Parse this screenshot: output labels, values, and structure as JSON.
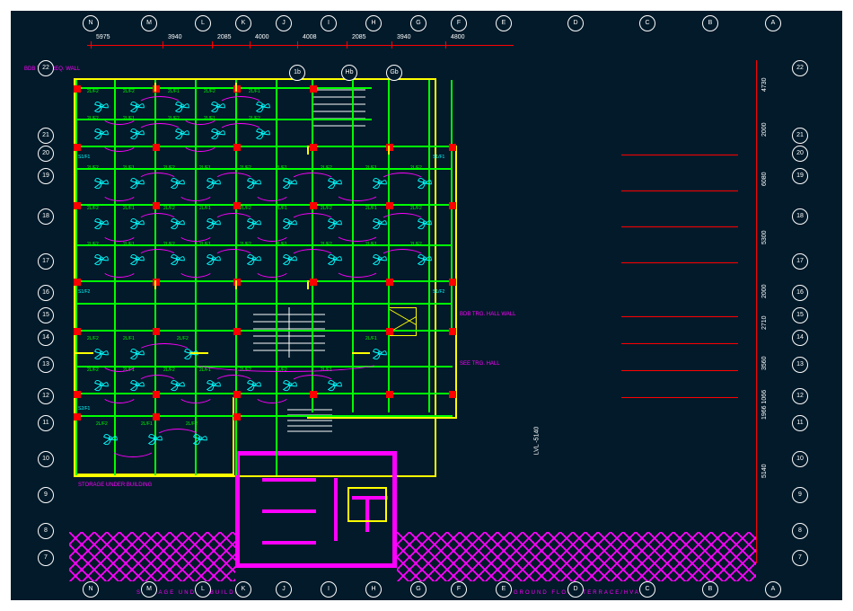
{
  "drawing": {
    "type": "CAD floor plan — HVAC / ceiling fan layout",
    "background": "#021a2a"
  },
  "grid_letters_top": [
    "N",
    "M",
    "L",
    "K",
    "J",
    "I",
    "H",
    "G",
    "F",
    "E",
    "D",
    "C",
    "B",
    "A"
  ],
  "grid_letters_bottom": [
    "N",
    "M",
    "L",
    "K",
    "J",
    "I",
    "H",
    "G",
    "F",
    "E",
    "D",
    "C",
    "B",
    "A"
  ],
  "grid_numbers_left": [
    "22",
    "21",
    "20",
    "19",
    "18",
    "17",
    "16",
    "15",
    "14",
    "13",
    "12",
    "11",
    "10",
    "9",
    "8",
    "7"
  ],
  "grid_numbers_right": [
    "22",
    "21",
    "20",
    "19",
    "18",
    "17",
    "16",
    "15",
    "14",
    "13",
    "12",
    "11",
    "10",
    "9",
    "8",
    "7"
  ],
  "dims_top": [
    "5975",
    "3940",
    "2085",
    "4000",
    "4008",
    "2085",
    "3940",
    "4800"
  ],
  "dims_right": [
    "4730",
    "2000",
    "6080",
    "5300",
    "2000",
    "2710",
    "3560",
    "1966 1066",
    "5140"
  ],
  "interior_bubbles": [
    "1b",
    "Hb",
    "Gb"
  ],
  "fan_tags": [
    "2L/F2",
    "2L/F2",
    "2L/F1",
    "2L/F2",
    "2L/F1",
    "2L/F2",
    "2L/F1",
    "2L/F2",
    "2L/F1"
  ],
  "switch_tags": [
    "S1/F1",
    "S1/F2",
    "S2/F1"
  ],
  "notes": {
    "left_1": "BDB TRG. REQ. WALL",
    "left_2": "STORAGE UNDER BUILDING",
    "right_1": "BDB TRG. HALL WALL",
    "right_2": "SEE TRG. HALL",
    "bottom_left": "STORAGE  UNDER  BUILDING",
    "bottom_right": "GROUND  FLOOR  TERRACE/HVAC",
    "level": "LVL -5140"
  },
  "colors": {
    "outline": "#ffff00",
    "beams": "#00ff00",
    "wiring": "#ff00ff",
    "fans": "#00ffff",
    "dims": "#ff0000",
    "text": "#ffffff",
    "hatch": "#ff00ff",
    "columns": "#ff0000"
  }
}
